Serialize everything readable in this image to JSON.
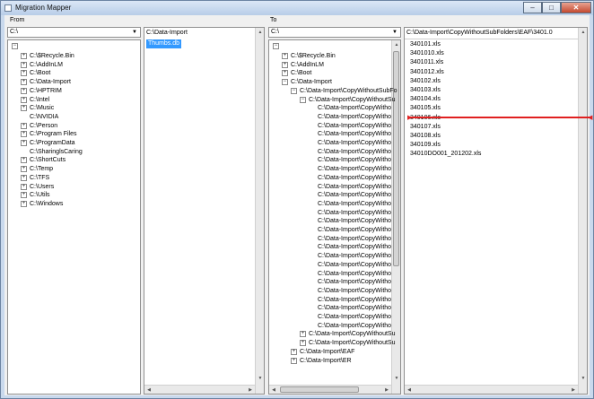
{
  "window": {
    "title": "Migration Mapper",
    "min": "–",
    "max": "□",
    "close": "✕"
  },
  "from": {
    "label": "From",
    "drive": "C:\\",
    "root_expander": "−",
    "tree": [
      "C:\\$Recycle.Bin",
      "C:\\AddInLM",
      "C:\\Boot",
      "C:\\Data-Import",
      "C:\\HPTRIM",
      "C:\\Intel",
      "C:\\Music",
      "C:\\NVIDIA",
      "C:\\Person",
      "C:\\Program Files",
      "C:\\ProgramData",
      "C:\\SharinglsCaring",
      "C:\\ShortCuts",
      "C:\\Temp",
      "C:\\TFS",
      "C:\\Users",
      "C:\\Utils",
      "C:\\Windows"
    ]
  },
  "from_files": {
    "header": "C:\\Data-Import",
    "selected": "Thumbs.db"
  },
  "to": {
    "label": "To",
    "drive": "C:\\",
    "root_expander": "−",
    "top": [
      "C:\\$Recycle.Bin",
      "C:\\AddInLM",
      "C:\\Boot",
      "C:\\Data-Import"
    ],
    "level2": "C:\\Data-Import\\CopyWithoutSubFo",
    "level3": "C:\\Data-Import\\CopyWithoutSu",
    "level4_item": "C:\\Data-Import\\CopyWitho",
    "level4_count": 26,
    "level3_tail": [
      "C:\\Data-Import\\CopyWithoutSu",
      "C:\\Data-Import\\CopyWithoutSu"
    ],
    "level2_tail": [
      "C:\\Data-Import\\EAF",
      "C:\\Data-Import\\ER"
    ]
  },
  "to_files": {
    "header": "C:\\Data-Import\\CopyWithoutSubFolders\\EAF\\3401.0",
    "items": [
      "340101.xls",
      "3401010.xls",
      "3401011.xls",
      "3401012.xls",
      "340102.xls",
      "340103.xls",
      "340104.xls",
      "340105.xls",
      "340106.xls",
      "340107.xls",
      "340108.xls",
      "340109.xls",
      "34010DO001_201202.xls"
    ]
  },
  "scroll": {
    "up": "▲",
    "down": "▼",
    "left": "◀",
    "right": "▶"
  },
  "colors": {
    "selection": "#3399ff",
    "drop_indicator": "#e02020"
  }
}
